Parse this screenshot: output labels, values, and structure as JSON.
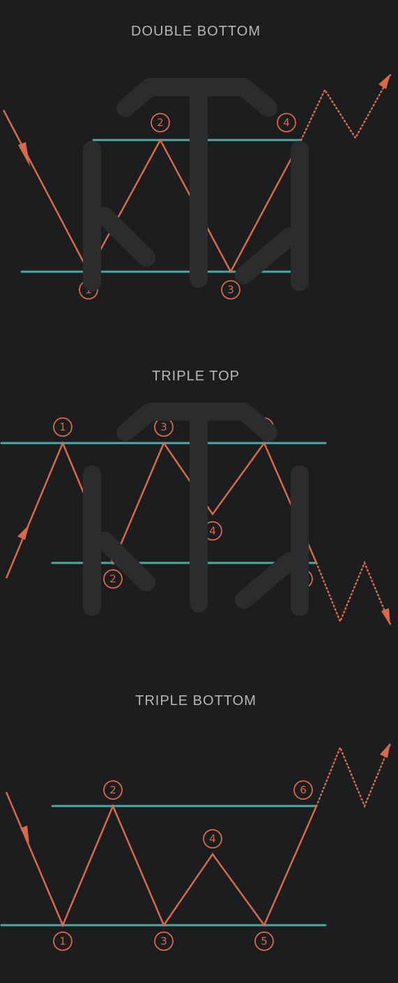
{
  "colors": {
    "background": "#1c1d1f",
    "price": "#d9694a",
    "level": "#4fa6a6",
    "title": "#b9b7b2",
    "watermark": "#2a2c2e"
  },
  "watermark": {
    "icon": "td-logo-icon"
  },
  "diagrams": [
    {
      "id": "double-bottom",
      "title": "DOUBLE BOTTOM",
      "markers": [
        "1",
        "2",
        "3",
        "4"
      ]
    },
    {
      "id": "triple-top",
      "title": "TRIPLE TOP",
      "markers": [
        "1",
        "2",
        "3",
        "4",
        "5",
        "6"
      ]
    },
    {
      "id": "triple-bottom",
      "title": "TRIPLE BOTTOM",
      "markers": [
        "1",
        "2",
        "3",
        "4",
        "5",
        "6"
      ]
    }
  ]
}
